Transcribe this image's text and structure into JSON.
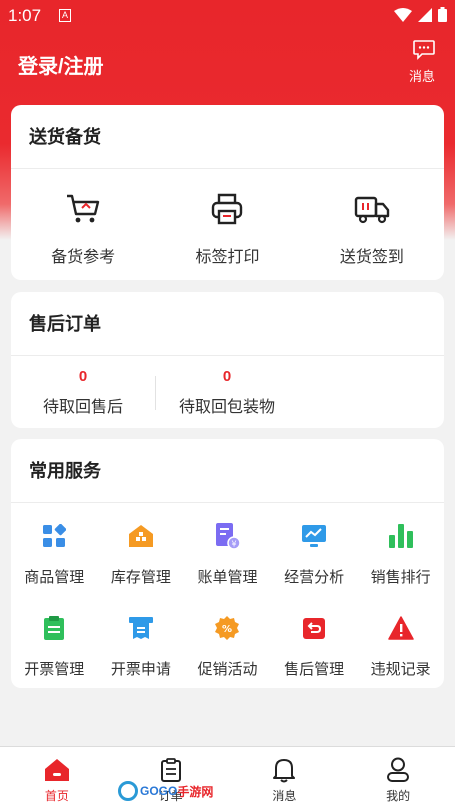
{
  "status_bar": {
    "time": "1:07",
    "notif_letter": "A"
  },
  "header": {
    "title": "登录/注册",
    "message_label": "消息"
  },
  "delivery": {
    "title": "送货备货",
    "items": [
      {
        "label": "备货参考",
        "icon": "shopping-cart-icon"
      },
      {
        "label": "标签打印",
        "icon": "printer-icon"
      },
      {
        "label": "送货签到",
        "icon": "delivery-truck-icon"
      }
    ]
  },
  "aftersale": {
    "title": "售后订单",
    "stats": [
      {
        "value": "0",
        "label": "待取回售后"
      },
      {
        "value": "0",
        "label": "待取回包装物"
      }
    ]
  },
  "services": {
    "title": "常用服务",
    "items": [
      {
        "label": "商品管理",
        "icon": "product-grid-icon",
        "color": "#3a8ee6"
      },
      {
        "label": "库存管理",
        "icon": "warehouse-icon",
        "color": "#f59a23"
      },
      {
        "label": "账单管理",
        "icon": "bill-icon",
        "color": "#7b6cf2"
      },
      {
        "label": "经营分析",
        "icon": "analytics-monitor-icon",
        "color": "#2f9ae8"
      },
      {
        "label": "销售排行",
        "icon": "bar-ranking-icon",
        "color": "#2fbf5b"
      },
      {
        "label": "开票管理",
        "icon": "clipboard-icon",
        "color": "#2fbf5b"
      },
      {
        "label": "开票申请",
        "icon": "invoice-receipt-icon",
        "color": "#2f9ae8"
      },
      {
        "label": "促销活动",
        "icon": "discount-badge-icon",
        "color": "#f59a23"
      },
      {
        "label": "售后管理",
        "icon": "return-box-icon",
        "color": "#e8262b"
      },
      {
        "label": "违规记录",
        "icon": "warning-triangle-icon",
        "color": "#e8262b"
      }
    ]
  },
  "tabbar": {
    "tabs": [
      {
        "label": "首页",
        "icon": "home-icon",
        "active": true
      },
      {
        "label": "订单",
        "icon": "order-list-icon",
        "active": false
      },
      {
        "label": "消息",
        "icon": "bell-icon",
        "active": false
      },
      {
        "label": "我的",
        "icon": "user-icon",
        "active": false
      }
    ]
  },
  "watermark": {
    "text_a": "GOGO",
    "text_b": "手游网"
  },
  "colors": {
    "brand_red": "#e8262b",
    "background": "#f2f2f2"
  }
}
